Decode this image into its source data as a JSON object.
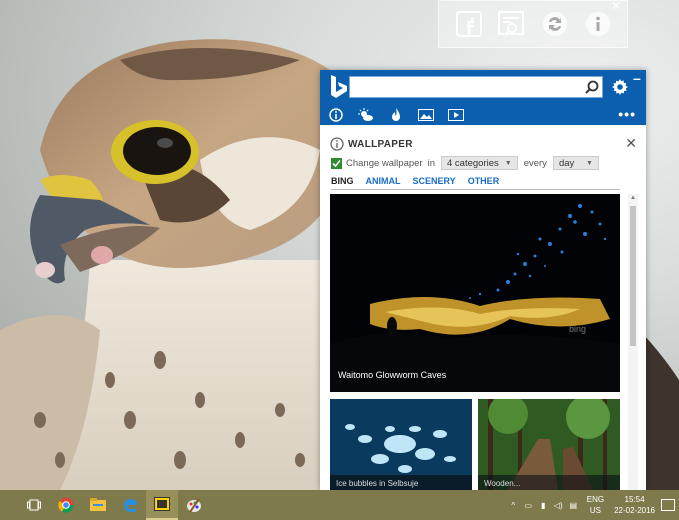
{
  "icons": {
    "floatbar": [
      "facebook-icon",
      "news-search-icon",
      "refresh-icon",
      "info-icon"
    ],
    "nav": [
      "info-icon",
      "weather-icon",
      "trending-icon",
      "image-icon",
      "video-icon"
    ],
    "taskbar": [
      "task-view-icon",
      "chrome-icon",
      "file-explorer-icon",
      "edge-icon",
      "bing-app-icon",
      "paint-icon"
    ]
  },
  "panel": {
    "section_title": "WALLPAPER",
    "change_label": "Change wallpaper",
    "in_label": "in",
    "categories_value": "4 categories",
    "every_label": "every",
    "interval_value": "day",
    "tabs": [
      "BING",
      "ANIMAL",
      "SCENERY",
      "OTHER"
    ],
    "big_caption": "Waitomo Glowworm Caves",
    "bing_watermark": "bing",
    "thumb1_caption": "Ice bubbles in Selbsuje",
    "thumb2_caption": "Wooden..."
  },
  "taskbar": {
    "lang_line1": "ENG",
    "lang_line2": "US",
    "time": "15:54",
    "date": "22-02-2016"
  },
  "colors": {
    "panel_header": "#0b5fae",
    "taskbar": "#7f7a4c",
    "tab_link": "#1a6cc8"
  }
}
